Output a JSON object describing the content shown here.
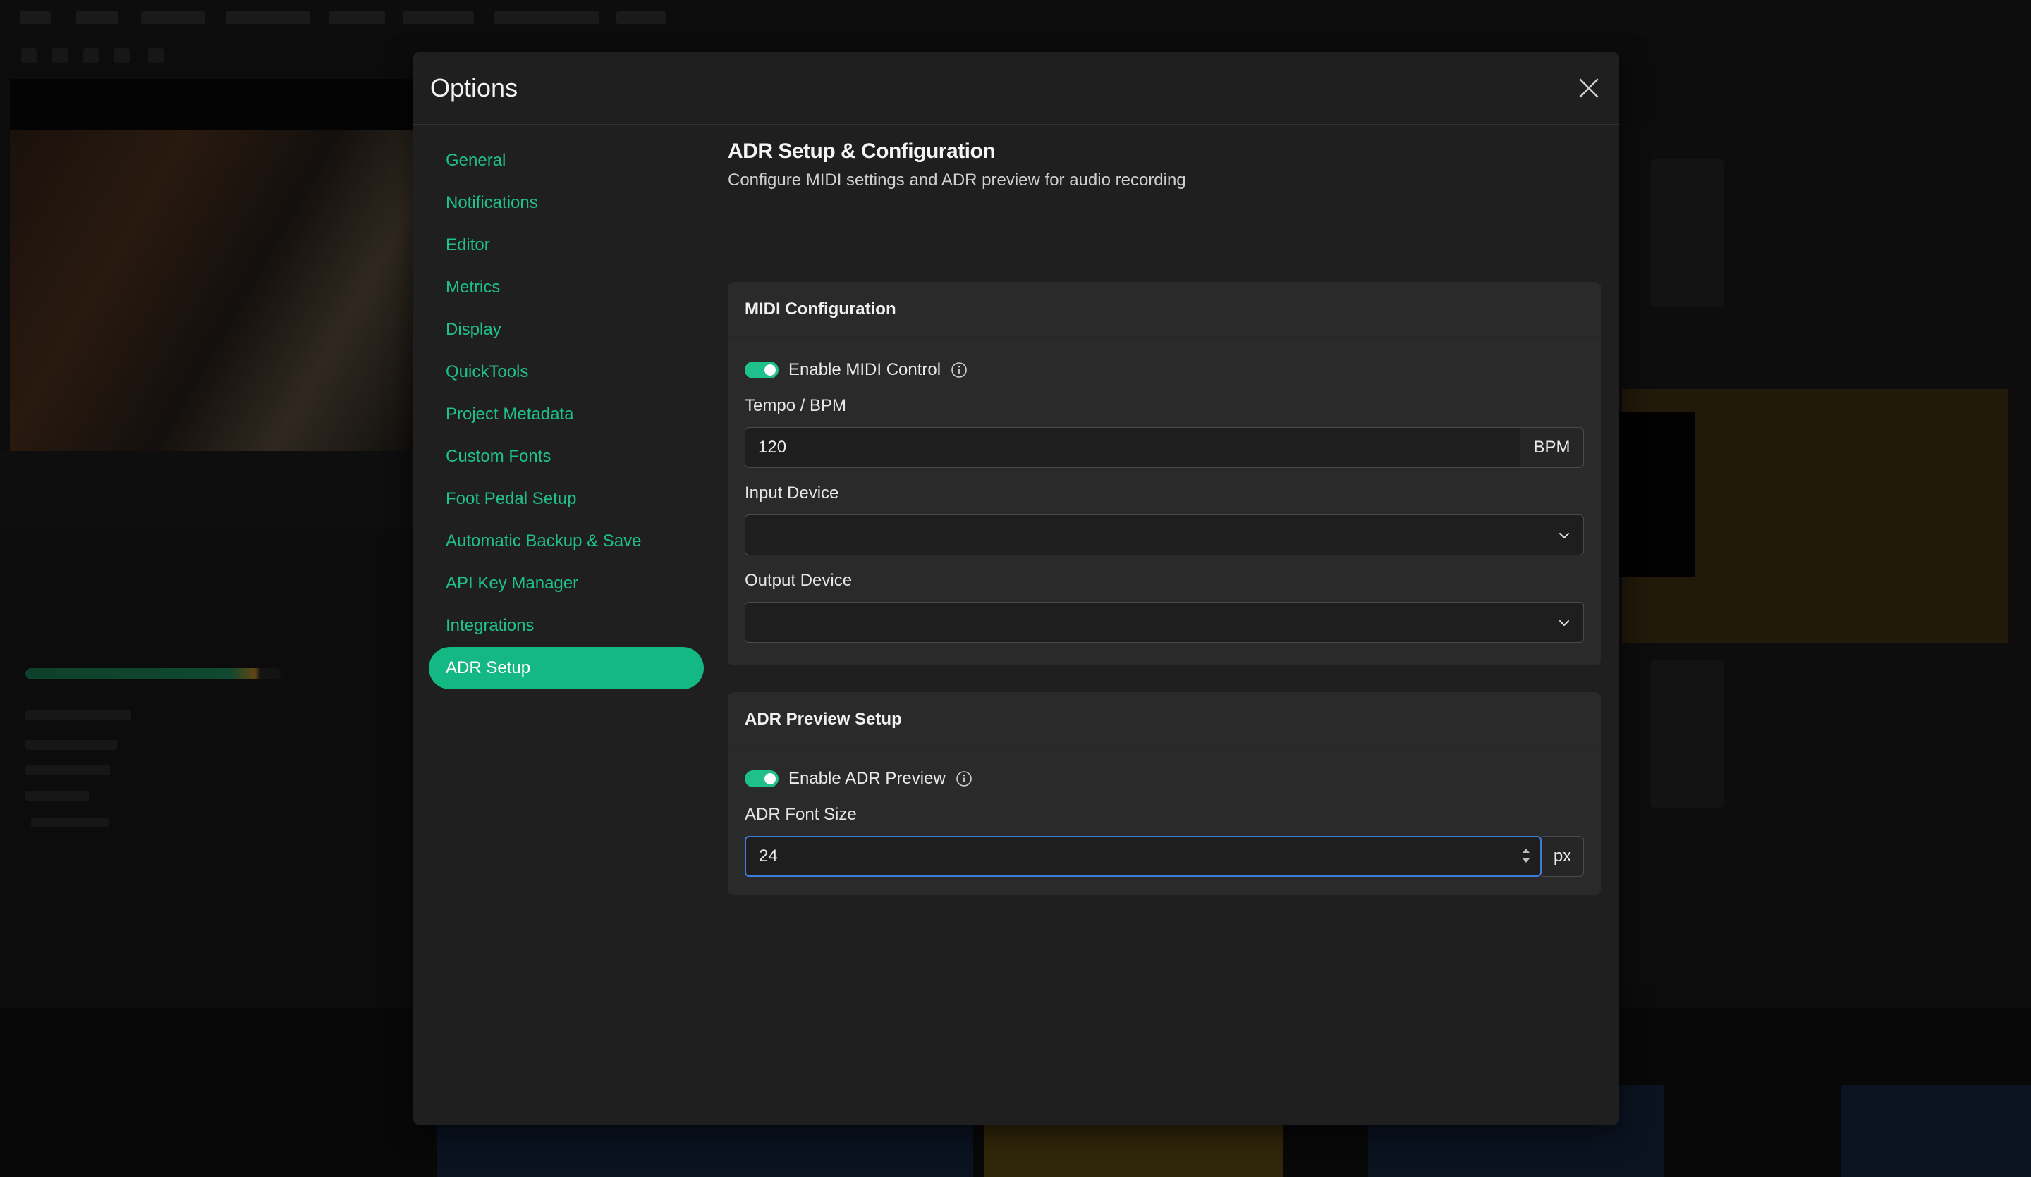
{
  "modal": {
    "title": "Options"
  },
  "sidebar": {
    "items": [
      {
        "label": "General"
      },
      {
        "label": "Notifications"
      },
      {
        "label": "Editor"
      },
      {
        "label": "Metrics"
      },
      {
        "label": "Display"
      },
      {
        "label": "QuickTools"
      },
      {
        "label": "Project Metadata"
      },
      {
        "label": "Custom Fonts"
      },
      {
        "label": "Foot Pedal Setup"
      },
      {
        "label": "Automatic Backup & Save"
      },
      {
        "label": "API Key Manager"
      },
      {
        "label": "Integrations"
      },
      {
        "label": "ADR Setup"
      }
    ],
    "active_index": 12
  },
  "content": {
    "title": "ADR Setup & Configuration",
    "subtitle": "Configure MIDI settings and ADR preview for audio recording"
  },
  "midi": {
    "heading": "MIDI Configuration",
    "enable_label": "Enable MIDI Control",
    "enabled": true,
    "tempo_label": "Tempo / BPM",
    "tempo_value": "120",
    "tempo_unit": "BPM",
    "input_label": "Input Device",
    "input_value": "",
    "output_label": "Output Device",
    "output_value": ""
  },
  "adr_preview": {
    "heading": "ADR Preview Setup",
    "enable_label": "Enable ADR Preview",
    "enabled": true,
    "font_size_label": "ADR Font Size",
    "font_size_value": "24",
    "font_size_unit": "px"
  },
  "colors": {
    "accent": "#13b883",
    "focus": "#3d7bd9",
    "modal_bg": "#1f1f1f",
    "card_bg": "#2a2a2a"
  },
  "icons": {
    "close": "close-icon",
    "info": "info-icon",
    "chevron": "chevron-down-icon",
    "spinner": "spinner-arrows-icon"
  }
}
